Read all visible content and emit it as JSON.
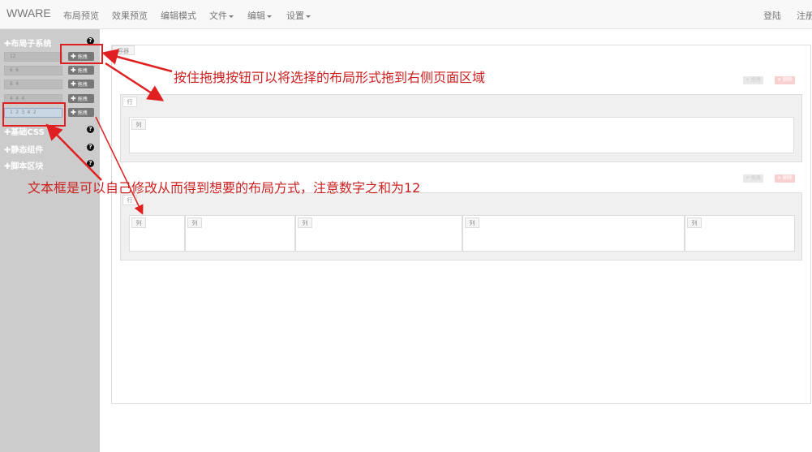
{
  "navbar": {
    "brand": "WWARE",
    "items": [
      "布局预览",
      "效果预览",
      "编辑模式"
    ],
    "dropdowns": [
      "文件",
      "编辑",
      "设置"
    ],
    "right": [
      "登陆",
      "注册"
    ]
  },
  "sidebar": {
    "sections": [
      "布局子系统",
      "基础CSS",
      "静态组件",
      "脚本区块"
    ],
    "help_glyph": "?",
    "layouts": [
      "12",
      "6 6",
      "8 4",
      "4 4 4",
      "1 2 3 4 2"
    ],
    "drag_label": "拖拽",
    "drag_glyph": "✚"
  },
  "canvas": {
    "container_label": "容器",
    "tool_drag": "+ 拖拽",
    "tool_delete": "✕ 删除",
    "row_label": "行",
    "col_label": "列"
  },
  "annotations": {
    "drag_hint": "按住拖拽按钮可以将选择的布局形式拖到右侧页面区域",
    "input_hint": "文本框是可以自己修改从而得到想要的布局方式，注意数字之和为12"
  },
  "colors": {
    "annotation_red": "#e02020",
    "sidebar_bg": "#cccccc",
    "navbar_bg": "#f8f8f8"
  }
}
